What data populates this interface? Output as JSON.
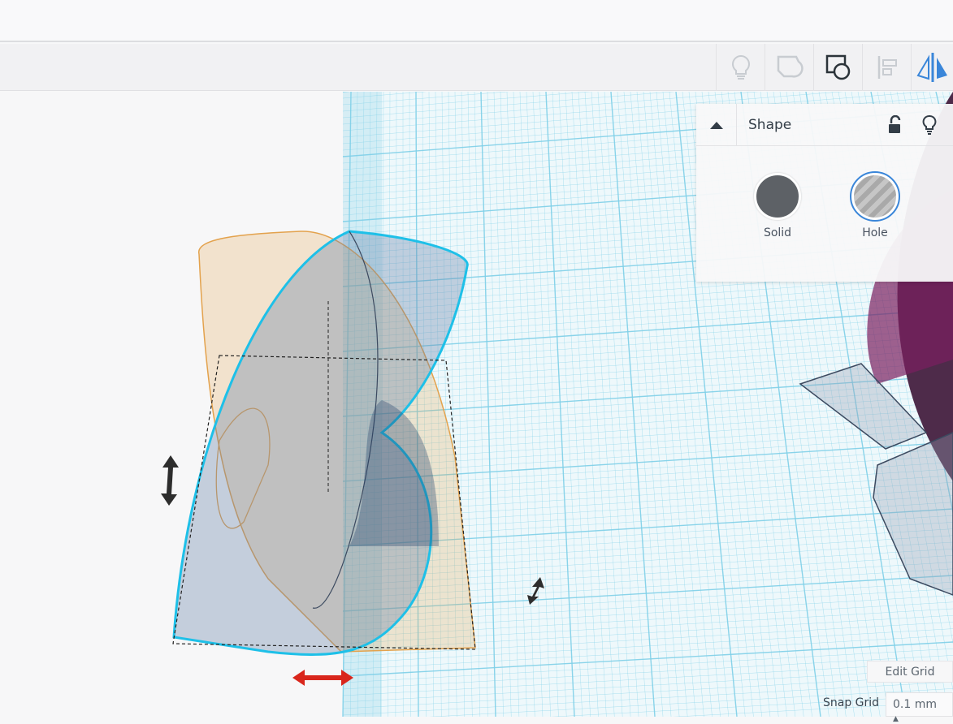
{
  "toolbar": {
    "icons": [
      "lightbulb-icon",
      "note-shape-icon",
      "group-shapes-icon",
      "align-icon",
      "mirror-icon"
    ],
    "active_color": "#2b3339",
    "mirror_color": "#3a86d9"
  },
  "shape_panel": {
    "title": "Shape",
    "options": [
      {
        "label": "Solid",
        "color": "#5d6166"
      },
      {
        "label": "Hole",
        "color": "#a9a9a9"
      }
    ]
  },
  "grid": {
    "edit_label": "Edit Grid",
    "snap_label": "Snap Grid",
    "snap_value": "0.1 mm"
  },
  "colors": {
    "grid": "#7fd0e8",
    "selection": "#1ec0e8",
    "orange": "#e3a24d",
    "arrow_red": "#d9261c"
  }
}
